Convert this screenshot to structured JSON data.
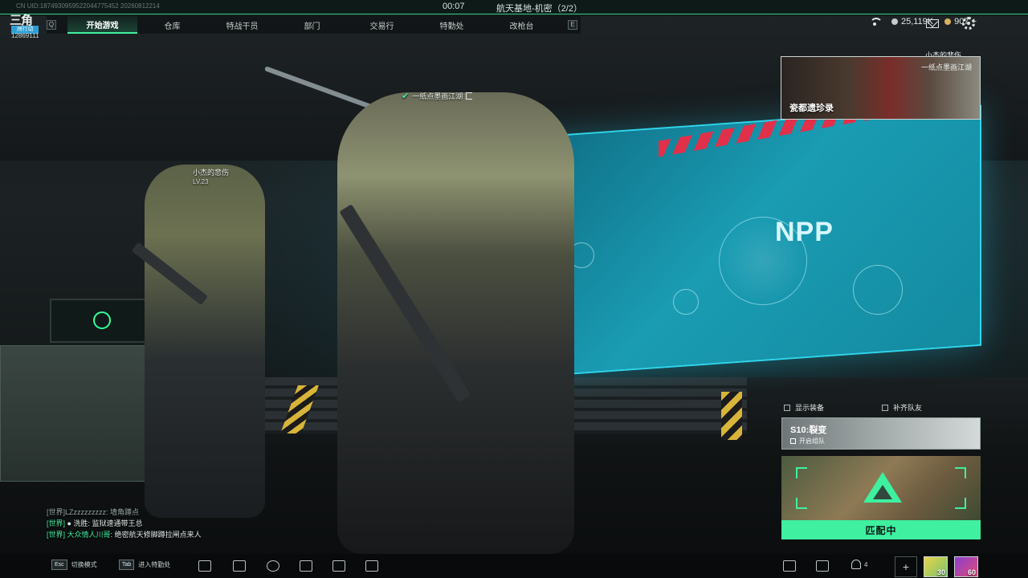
{
  "top": {
    "uid_text": "CN UID:1874930959522044775452 20260812214",
    "timer": "00:07",
    "map_info": "航天基地-机密（2/2）"
  },
  "logo": {
    "main": "三角",
    "sub": "洲行动",
    "id": "12869111"
  },
  "nav": {
    "left_key": "Q",
    "right_key": "E",
    "tabs": [
      "开始游戏",
      "仓库",
      "特战干员",
      "部门",
      "交易行",
      "特勤处",
      "改枪台"
    ],
    "active_index": 0
  },
  "currency": {
    "silver": "25,119K",
    "gold": "907",
    "gold_add": "+"
  },
  "nametags": {
    "main_player": "一纸点墨画江湖",
    "teammate": "小杰的悲伤",
    "teammate_level": "LV.23"
  },
  "promo": {
    "label_top": "小杰的悲伤",
    "label_second": "一纸点墨画江湖",
    "title": "瓷都遗珍录"
  },
  "panel": {
    "show_equipment": "显示装备",
    "fill_team": "补齐队友",
    "season_title": "S10:裂变",
    "season_sub": "开启组队",
    "match_button": "匹配中"
  },
  "chat": [
    {
      "channel": "[世界]",
      "name": "LZzzzzzzzzz",
      "text": "墙角蹲点",
      "faded": true
    },
    {
      "channel": "[世界]",
      "name": "● 洗胜",
      "text": "监狱速通带王总",
      "faded": false
    },
    {
      "channel": "[世界]",
      "name": "大众情人川哥",
      "text": "绝密航天修脚蹲拉闸点来人",
      "faded": false
    }
  ],
  "bottom": {
    "hint1_key": "Esc",
    "hint1_label": "切换模式",
    "hint2_key": "Tab",
    "hint2_label": "进入特勤处",
    "friends_count": "4",
    "avatar1_level": "30",
    "avatar2_level": "60"
  },
  "colors": {
    "accent": "#3ef0a0",
    "screen": "#1a9cb3"
  }
}
